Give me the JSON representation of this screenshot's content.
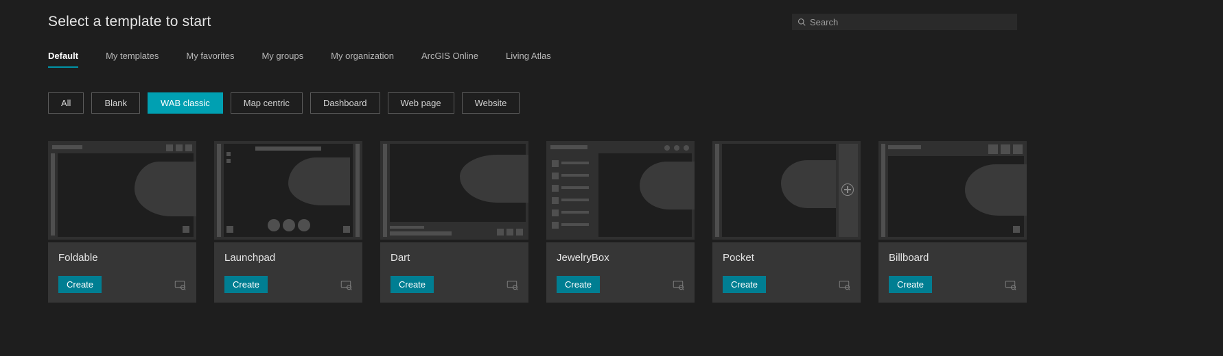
{
  "title": "Select a template to start",
  "search": {
    "placeholder": "Search"
  },
  "tabs": [
    {
      "label": "Default",
      "active": true
    },
    {
      "label": "My templates",
      "active": false
    },
    {
      "label": "My favorites",
      "active": false
    },
    {
      "label": "My groups",
      "active": false
    },
    {
      "label": "My organization",
      "active": false
    },
    {
      "label": "ArcGIS Online",
      "active": false
    },
    {
      "label": "Living Atlas",
      "active": false
    }
  ],
  "filters": [
    {
      "label": "All",
      "active": false
    },
    {
      "label": "Blank",
      "active": false
    },
    {
      "label": "WAB classic",
      "active": true
    },
    {
      "label": "Map centric",
      "active": false
    },
    {
      "label": "Dashboard",
      "active": false
    },
    {
      "label": "Web page",
      "active": false
    },
    {
      "label": "Website",
      "active": false
    }
  ],
  "cards": [
    {
      "name": "Foldable",
      "create_label": "Create"
    },
    {
      "name": "Launchpad",
      "create_label": "Create"
    },
    {
      "name": "Dart",
      "create_label": "Create"
    },
    {
      "name": "JewelryBox",
      "create_label": "Create"
    },
    {
      "name": "Pocket",
      "create_label": "Create"
    },
    {
      "name": "Billboard",
      "create_label": "Create"
    }
  ],
  "colors": {
    "accent": "#007e92",
    "accent_bright": "#00a0b2",
    "bg": "#1e1e1e",
    "panel": "#303030",
    "card_info": "#363636"
  }
}
